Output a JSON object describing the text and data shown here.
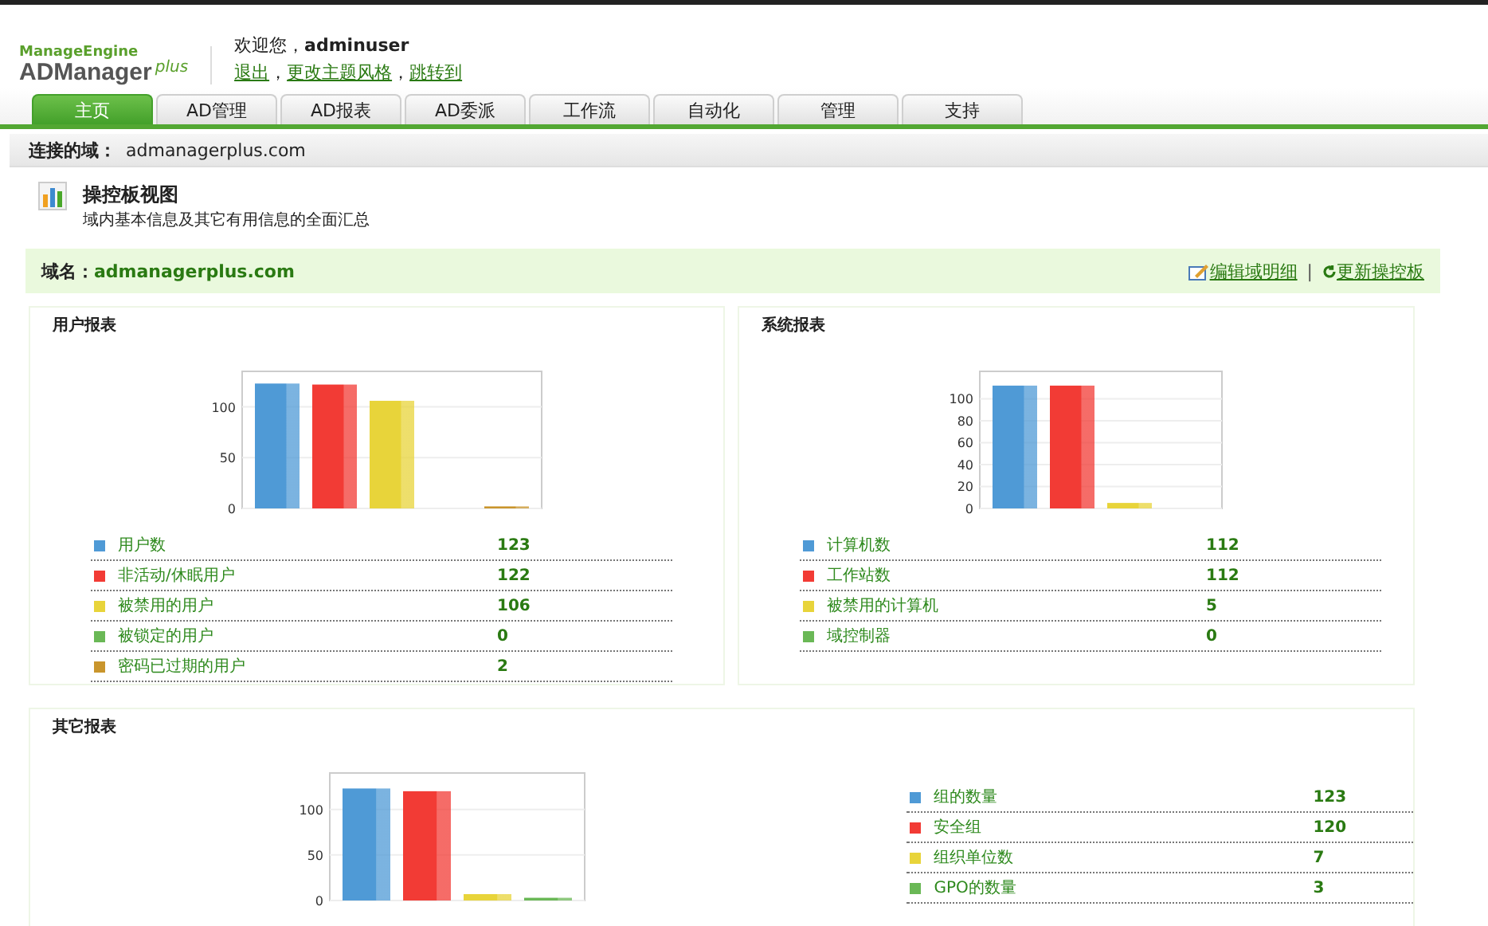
{
  "logo": {
    "brand": "ManageEngine",
    "product": "ADManager",
    "suffix": "plus"
  },
  "header": {
    "greeting": "欢迎您，",
    "user": "adminuser",
    "links": [
      {
        "label": "退出"
      },
      {
        "prefix": "，",
        "label": "更改主题风格"
      },
      {
        "prefix": "，",
        "label": "跳转到"
      }
    ]
  },
  "tabs": [
    {
      "label": "主页",
      "selected": true
    },
    {
      "label": "AD管理",
      "selected": false
    },
    {
      "label": "AD报表",
      "selected": false
    },
    {
      "label": "AD委派",
      "selected": false
    },
    {
      "label": "工作流",
      "selected": false
    },
    {
      "label": "自动化",
      "selected": false
    },
    {
      "label": "管理",
      "selected": false
    },
    {
      "label": "支持",
      "selected": false
    }
  ],
  "connected_domain": {
    "label": "连接的域：",
    "value": "admanagerplus.com"
  },
  "page_title": {
    "title": "操控板视图",
    "subtitle": "域内基本信息及其它有用信息的全面汇总"
  },
  "domain_bar": {
    "label": "域名：",
    "value": "admanagerplus.com",
    "actions": [
      {
        "label": "编辑域明细"
      },
      {
        "label": "更新操控板"
      }
    ],
    "divider": "|"
  },
  "panels": [
    {
      "title": "用户报表",
      "kind": "stacked",
      "items": [
        {
          "label": "用户数",
          "value": "123",
          "color": "#4f9ad6"
        },
        {
          "label": "非活动/休眠用户",
          "value": "122",
          "color": "#f23b35"
        },
        {
          "label": "被禁用的用户",
          "value": "106",
          "color": "#e8d43a"
        },
        {
          "label": "被锁定的用户",
          "value": "0",
          "color": "#6ab856"
        },
        {
          "label": "密码已过期的用户",
          "value": "2",
          "color": "#c9952c"
        }
      ],
      "chart_data": {
        "type": "bar",
        "values": [
          123,
          122,
          106,
          0,
          2
        ],
        "ylim": [
          0,
          135
        ],
        "yticks": [
          0,
          50,
          100
        ],
        "grid": true
      }
    },
    {
      "title": "系统报表",
      "kind": "stacked",
      "items": [
        {
          "label": "计算机数",
          "value": "112",
          "color": "#4f9ad6"
        },
        {
          "label": "工作站数",
          "value": "112",
          "color": "#f23b35"
        },
        {
          "label": "被禁用的计算机",
          "value": "5",
          "color": "#e8d43a"
        },
        {
          "label": "域控制器",
          "value": "0",
          "color": "#6ab856"
        }
      ],
      "chart_data": {
        "type": "bar",
        "values": [
          112,
          112,
          5,
          0
        ],
        "ylim": [
          0,
          125
        ],
        "yticks": [
          0,
          20,
          40,
          60,
          80,
          100
        ],
        "grid": true
      }
    },
    {
      "title": "其它报表",
      "kind": "side",
      "items": [
        {
          "label": "组的数量",
          "value": "123",
          "color": "#4f9ad6"
        },
        {
          "label": "安全组",
          "value": "120",
          "color": "#f23b35"
        },
        {
          "label": "组织单位数",
          "value": "7",
          "color": "#e8d43a"
        },
        {
          "label": "GPO的数量",
          "value": "3",
          "color": "#6ab856"
        }
      ],
      "chart_data": {
        "type": "bar",
        "values": [
          123,
          120,
          7,
          3
        ],
        "ylim": [
          0,
          140
        ],
        "yticks": [
          0,
          50,
          100
        ],
        "grid": true
      }
    }
  ]
}
